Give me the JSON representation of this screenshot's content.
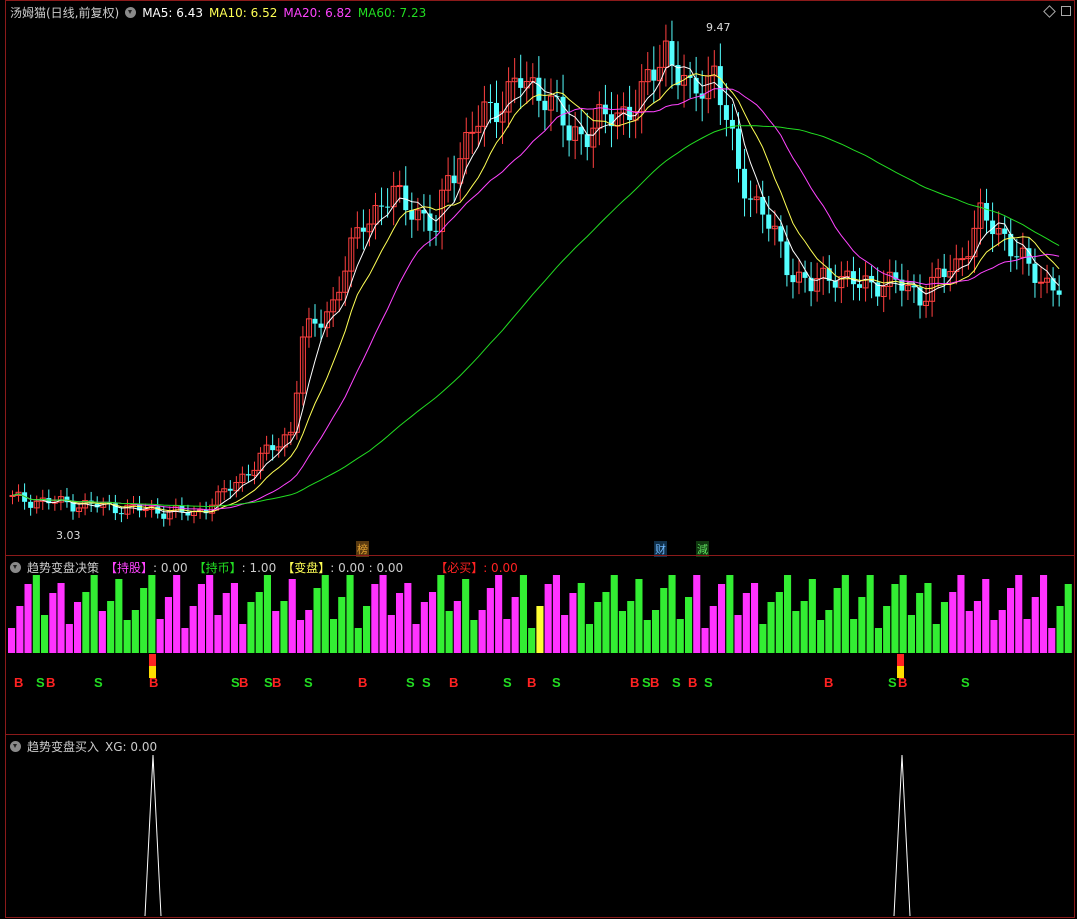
{
  "stock": {
    "title": "汤姆猫(日线,前复权)",
    "ma": [
      {
        "label": "MA5: 6.43",
        "color": "#ffffff"
      },
      {
        "label": "MA10: 6.52",
        "color": "#ffff55"
      },
      {
        "label": "MA20: 6.82",
        "color": "#ff44ff"
      },
      {
        "label": "MA60: 7.23",
        "color": "#22dd22"
      }
    ],
    "high_label": "9.47",
    "low_label": "3.03",
    "markers": [
      {
        "text": "榜",
        "color": "#e0a030"
      },
      {
        "text": "财",
        "color": "#6fb8ff"
      },
      {
        "text": "減",
        "color": "#5fdf5f"
      }
    ]
  },
  "indicator1": {
    "name": "趋势变盘决策",
    "items": [
      {
        "label": "【持股】",
        "value": ": 0.00",
        "label_color": "#ff44ff"
      },
      {
        "label": "【持币】",
        "value": ": 1.00",
        "label_color": "#22dd22"
      },
      {
        "label": "【变盘】",
        "value": ": 0.00 : 0.00",
        "label_color": "#ffff55"
      },
      {
        "label": "【必买】",
        "value": ": 0.00",
        "label_color": "#ff2222"
      }
    ],
    "bars": [
      "M",
      "M",
      "M",
      "G",
      "G",
      "M",
      "M",
      "M",
      "M",
      "G",
      "G",
      "M",
      "G",
      "G",
      "G",
      "G",
      "G",
      "G",
      "M",
      "M",
      "M",
      "M",
      "M",
      "M",
      "M",
      "M",
      "M",
      "M",
      "M",
      "G",
      "G",
      "G",
      "M",
      "G",
      "M",
      "M",
      "M",
      "G",
      "G",
      "G",
      "G",
      "G",
      "G",
      "G",
      "M",
      "M",
      "M",
      "M",
      "M",
      "M",
      "M",
      "M",
      "G",
      "G",
      "M",
      "G",
      "G",
      "M",
      "M",
      "M",
      "M",
      "M",
      "G",
      "G",
      "Y",
      "M",
      "M",
      "M",
      "M",
      "G",
      "G",
      "G",
      "G",
      "G",
      "G",
      "G",
      "G",
      "G",
      "G",
      "G",
      "G",
      "G",
      "G",
      "M",
      "M",
      "M",
      "M",
      "G",
      "M",
      "M",
      "M",
      "G",
      "G",
      "G",
      "G",
      "G",
      "G",
      "G",
      "G",
      "G",
      "G",
      "G",
      "G",
      "G",
      "G",
      "G",
      "G",
      "G",
      "G",
      "G",
      "G",
      "G",
      "G",
      "G",
      "M",
      "M",
      "M",
      "M",
      "M",
      "M",
      "M",
      "M",
      "M",
      "M",
      "M",
      "M",
      "M",
      "G",
      "G"
    ],
    "signals": [
      {
        "t": "B",
        "c": "#ff2222"
      },
      {
        "t": "S",
        "c": "#22dd22"
      },
      {
        "t": "B",
        "c": "#ff2222"
      },
      {
        "t": "S",
        "c": "#22dd22"
      },
      {
        "t": "B",
        "c": "#ff2222"
      },
      {
        "t": "S",
        "c": "#22dd22"
      },
      {
        "t": "B",
        "c": "#ff2222"
      },
      {
        "t": "S",
        "c": "#22dd22"
      },
      {
        "t": "B",
        "c": "#ff2222"
      },
      {
        "t": "S",
        "c": "#22dd22"
      },
      {
        "t": "B",
        "c": "#ff2222"
      },
      {
        "t": "S",
        "c": "#22dd22"
      },
      {
        "t": "S",
        "c": "#22dd22"
      },
      {
        "t": "B",
        "c": "#ff2222"
      },
      {
        "t": "S",
        "c": "#22dd22"
      },
      {
        "t": "B",
        "c": "#ff2222"
      },
      {
        "t": "S",
        "c": "#22dd22"
      },
      {
        "t": "B",
        "c": "#ff2222"
      },
      {
        "t": "S",
        "c": "#22dd22"
      },
      {
        "t": "B",
        "c": "#ff2222"
      },
      {
        "t": "S",
        "c": "#22dd22"
      },
      {
        "t": "B",
        "c": "#ff2222"
      },
      {
        "t": "S",
        "c": "#22dd22"
      },
      {
        "t": "B",
        "c": "#ff2222"
      },
      {
        "t": "S",
        "c": "#22dd22"
      },
      {
        "t": "B",
        "c": "#ff2222"
      },
      {
        "t": "S",
        "c": "#22dd22"
      }
    ]
  },
  "indicator2": {
    "name": "趋势变盘买入",
    "value_label": "XG: 0.00"
  }
}
